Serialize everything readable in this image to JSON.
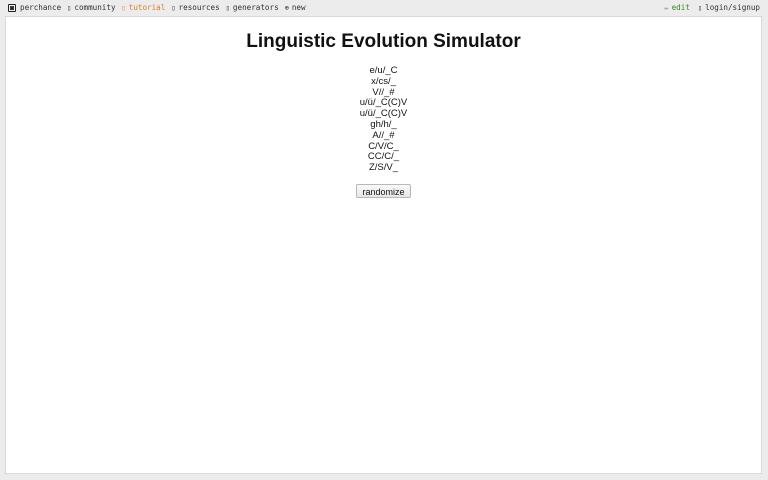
{
  "nav": {
    "items": [
      {
        "label": "perchance",
        "icon": "dice-icon"
      },
      {
        "label": "community",
        "icon": "chat-icon",
        "glyph": "▯"
      },
      {
        "label": "tutorial",
        "icon": "book-icon",
        "glyph": "▯"
      },
      {
        "label": "resources",
        "icon": "resources-icon",
        "glyph": "▯"
      },
      {
        "label": "generators",
        "icon": "generators-icon",
        "glyph": "▯"
      },
      {
        "label": "new",
        "icon": "plus-circle-icon",
        "glyph": "⊕"
      }
    ],
    "active": "tutorial",
    "right": [
      {
        "label": "edit",
        "icon": "pencil-icon",
        "glyph": "✏"
      },
      {
        "label": "login/signup",
        "icon": "user-icon",
        "glyph": "▯"
      }
    ]
  },
  "colors": {
    "active_link": "#d9822b",
    "edit_link": "#3c8a2e"
  },
  "main": {
    "title": "Linguistic Evolution Simulator",
    "rules": [
      "e/u/_C",
      "x/cs/_",
      "V//_#",
      "u/ü/_C(C)V",
      "u/ü/_C(C)V",
      "gh/h/_",
      "A//_#",
      "C/V/C_",
      "CC/C/_",
      "Z/S/V_"
    ],
    "button_label": "randomize"
  }
}
